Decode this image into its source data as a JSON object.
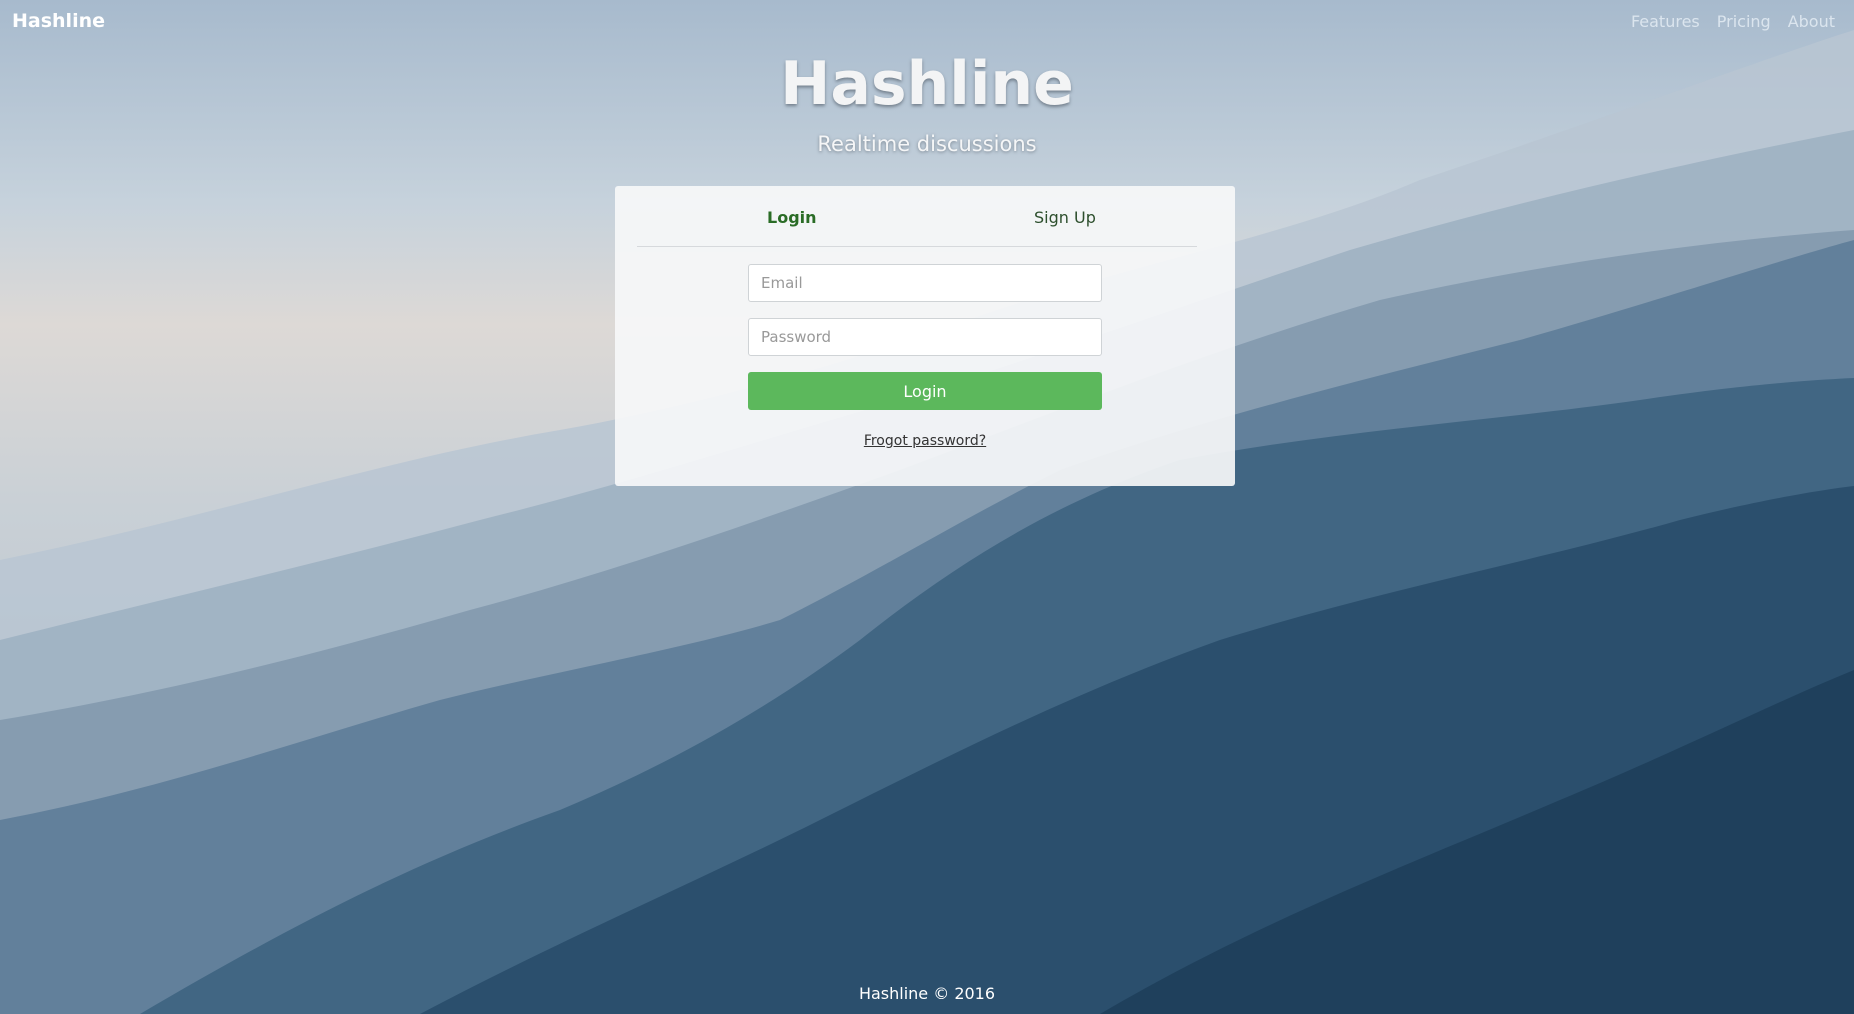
{
  "navbar": {
    "brand": "Hashline",
    "links": [
      "Features",
      "Pricing",
      "About"
    ]
  },
  "hero": {
    "title": "Hashline",
    "subtitle": "Realtime discussions"
  },
  "auth_card": {
    "tabs": [
      {
        "label": "Login",
        "active": true
      },
      {
        "label": "Sign Up",
        "active": false
      }
    ],
    "email_placeholder": "Email",
    "password_placeholder": "Password",
    "login_button": "Login",
    "forgot_link": "Frogot password?"
  },
  "footer": {
    "text": "Hashline © 2016"
  },
  "colors": {
    "primary_button": "#5cb85c",
    "tab_text": "#2a6c26"
  }
}
